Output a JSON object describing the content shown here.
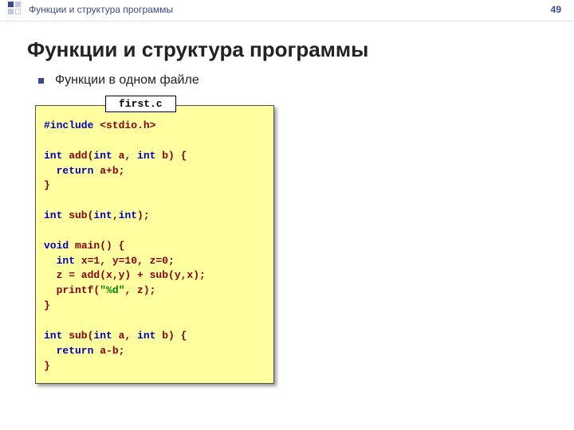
{
  "header": {
    "title": "Функции и структура программы",
    "page_number": "49"
  },
  "main_title": "Функции и структура программы",
  "bullet": "Функции в одном файле",
  "code": {
    "filename": "first.c",
    "lines": {
      "l1a": "#include",
      "l1b": " <stdio.h>",
      "l3a": "int",
      "l3b": " add(",
      "l3c": "int",
      "l3d": " a, ",
      "l3e": "int",
      "l3f": " b) {",
      "l4a": "  return",
      "l4b": " a+b;",
      "l5": "}",
      "l7a": "int",
      "l7b": " sub(",
      "l7c": "int",
      "l7d": ",",
      "l7e": "int",
      "l7f": ");",
      "l9a": "void",
      "l9b": " main() {",
      "l10a": "  int",
      "l10b": " x=1, y=10, z=0;",
      "l11": "  z = add(x,y) + sub(y,x);",
      "l12a": "  printf(",
      "l12b": "\"%d\"",
      "l12c": ", z);",
      "l13": "}",
      "l15a": "int",
      "l15b": " sub(",
      "l15c": "int",
      "l15d": " a, ",
      "l15e": "int",
      "l15f": " b) {",
      "l16a": "  return",
      "l16b": " a-b;",
      "l17": "}"
    }
  }
}
